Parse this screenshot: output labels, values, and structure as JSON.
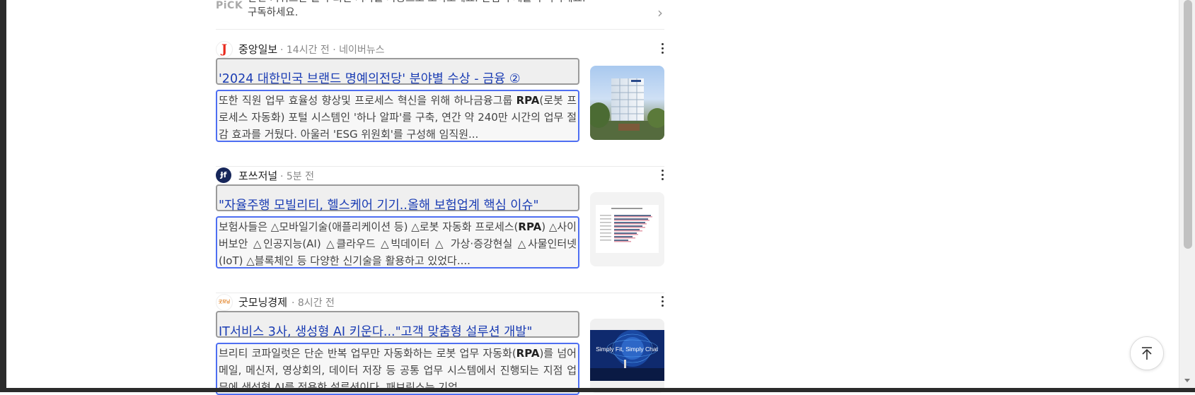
{
  "pick": {
    "label": "PiCK",
    "text": "관련 키워드만 골라 최신 기사를 자동으로 모아보세요. 관심 주제를 구독하세요.",
    "text_line2": "구독하세요."
  },
  "articles": [
    {
      "source": "중앙일보",
      "meta": "· 14시간 전 · 네이버뉴스",
      "logo_letter": "J",
      "title": "'2024 대한민국 브랜드 명예의전당' 분야별 수상 - 금융 ②",
      "snippet_before": "또한 직원 업무 효율성 향상및 프로세스 혁신을 위해 하나금융그룹 ",
      "snippet_bold": "RPA",
      "snippet_after": "(로봇 프로세스 자동화) 포털 시스템인 '하나 알파'를 구축, 연간 약 240만 시간의 업무 절감 효과를 거뒀다. 아울러 'ESG 위원회'를 구성해 임직원..."
    },
    {
      "source": "포쓰저널",
      "meta": "· 5분 전",
      "logo_letter": "Ɉf",
      "title": "\"자율주행 모빌리티, 헬스케어 기기..올해 보험업계 핵심 이슈\"",
      "snippet_before": "보험사들은 △모바일기술(애플리케이션 등) △로봇 자동화 프로세스(",
      "snippet_bold": "RPA",
      "snippet_after": ") △사이버보안 △인공지능(AI) △클라우드 △빅데이터 △ 가상·증강현실 △사물인터넷(IoT) △블록체인 등 다양한 신기술을 활용하고 있었다...."
    },
    {
      "source": "굿모닝경제",
      "meta": "· 8시간 전",
      "logo_letter": "굿모닝경제",
      "title": "IT서비스 3사, 생성형 AI 키운다...\"고객 맞춤형 설루션 개발\"",
      "snippet_before": "브리티 코파일럿은 단순 반복 업무만 자동화하는 로봇 업무 자동화(",
      "snippet_bold": "RPA",
      "snippet_after": ")를 넘어 메일, 메신저, 영상회의, 데이터 저장 등 공통 업무 시스템에서 진행되는 지점 업무에 생성형 AI를 적용한 설루션이다. 패브릭스는 기업..."
    }
  ],
  "thumb3_caption": "Simply Fit, Simply Chat",
  "colors": {
    "title_link": "#1a3cb3",
    "snippet_outline": "#4e6ef2",
    "title_outline": "#9a9a9a"
  },
  "icons": {
    "more": "more-vertical-icon",
    "chevron": "chevron-right-icon",
    "scroll_top": "arrow-up-icon"
  }
}
